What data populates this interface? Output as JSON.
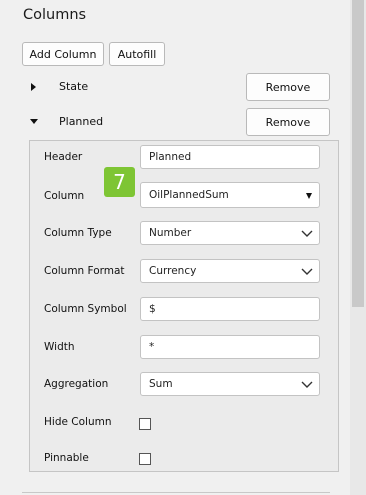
{
  "panel": {
    "title": "Columns",
    "add_column_label": "Add Column",
    "autofill_label": "Autofill"
  },
  "columns": [
    {
      "name": "State",
      "expanded": false,
      "remove_label": "Remove"
    },
    {
      "name": "Planned",
      "expanded": true,
      "remove_label": "Remove"
    }
  ],
  "details": {
    "header": {
      "label": "Header",
      "value": "Planned"
    },
    "column": {
      "label": "Column",
      "value": "OilPlannedSum"
    },
    "column_type": {
      "label": "Column Type",
      "value": "Number"
    },
    "column_format": {
      "label": "Column Format",
      "value": "Currency"
    },
    "column_symbol": {
      "label": "Column Symbol",
      "value": "$"
    },
    "width": {
      "label": "Width",
      "value": "*"
    },
    "aggregation": {
      "label": "Aggregation",
      "value": "Sum"
    },
    "hide_column": {
      "label": "Hide Column",
      "checked": false
    },
    "pinnable": {
      "label": "Pinnable",
      "checked": false
    }
  },
  "badge": {
    "text": "7",
    "color": "#7ec534"
  },
  "icons": {
    "collapsed": "caret-right-icon",
    "expanded": "caret-down-icon",
    "dropdown": "chevron-down-icon"
  }
}
